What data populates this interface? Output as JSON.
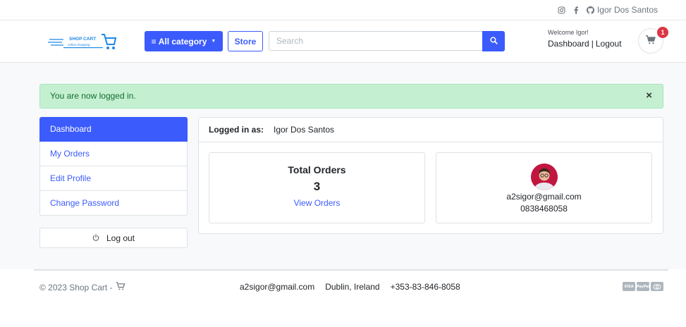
{
  "topbar": {
    "instagram_icon": "instagram-icon",
    "facebook_icon": "facebook-icon",
    "github_icon": "github-icon",
    "user_name": "Igor Dos Santos"
  },
  "header": {
    "logo_title": "SHOP CART",
    "logo_subtitle": "online shopping",
    "category_button": "All category",
    "store_button": "Store",
    "search_placeholder": "Search",
    "welcome": "Welcome Igor!",
    "dashboard_link": "Dashboard",
    "separator": "|",
    "logout_link": "Logout",
    "cart_count": "1"
  },
  "alert": {
    "message": "You are now logged in.",
    "close": "×"
  },
  "sidebar": {
    "items": [
      {
        "label": "Dashboard",
        "active": true
      },
      {
        "label": "My Orders"
      },
      {
        "label": "Edit Profile"
      },
      {
        "label": "Change Password"
      }
    ],
    "logout_label": "Log out"
  },
  "panel": {
    "logged_label": "Logged in as:",
    "user_name": "Igor Dos Santos",
    "orders": {
      "title": "Total Orders",
      "count": "3",
      "link": "View Orders"
    },
    "user": {
      "email": "a2sigor@gmail.com",
      "phone": "0838468058"
    }
  },
  "footer": {
    "copyright": "© 2023 Shop Cart -",
    "email": "a2sigor@gmail.com",
    "location": "Dublin, Ireland",
    "phone": "+353-83-846-8058",
    "payments": [
      "VISA",
      "PayPal",
      "MC"
    ]
  },
  "colors": {
    "accent": "#3b5bfd",
    "alert_bg": "#c4f0d1",
    "badge": "#dc3545"
  }
}
